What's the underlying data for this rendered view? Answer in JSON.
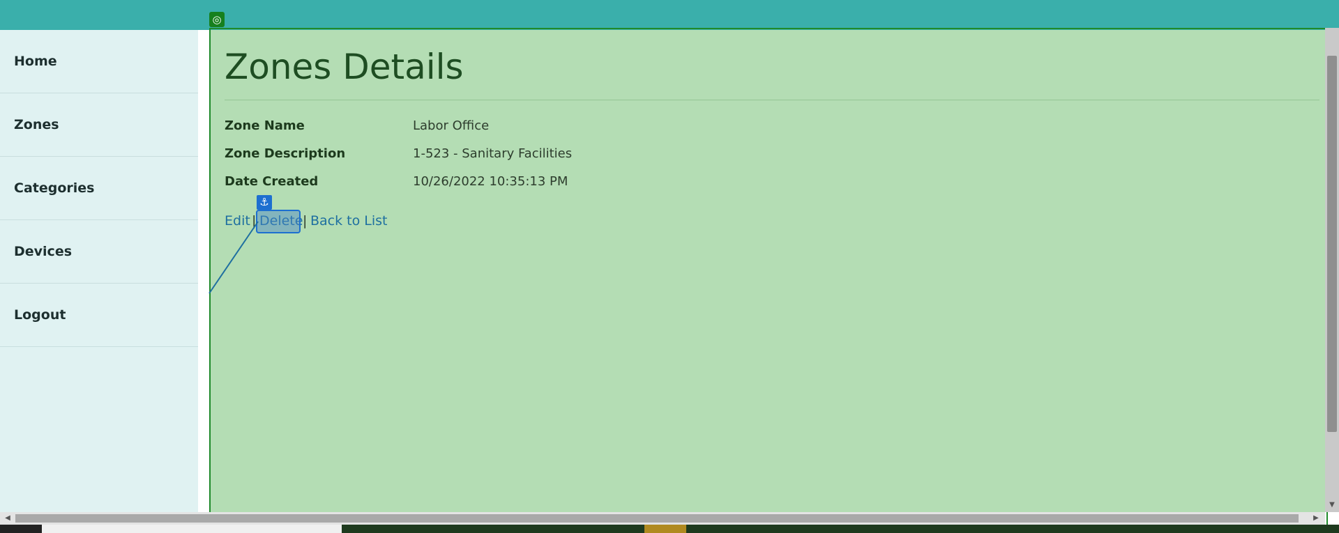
{
  "sidebar": {
    "items": [
      {
        "label": "Home"
      },
      {
        "label": "Zones"
      },
      {
        "label": "Categories"
      },
      {
        "label": "Devices"
      },
      {
        "label": "Logout"
      }
    ]
  },
  "main": {
    "title": "Zones Details",
    "details": [
      {
        "term": "Zone Name",
        "value": "Labor Office"
      },
      {
        "term": "Zone Description",
        "value": "1-523 - Sanitary Facilities"
      },
      {
        "term": "Date Created",
        "value": "10/26/2022 10:35:13 PM"
      }
    ],
    "actions": {
      "edit": "Edit",
      "separator": "|",
      "delete": "Delete",
      "back": "Back to List"
    }
  },
  "overlay": {
    "anchor_icon": "anchor-icon",
    "target_icon": "target-icon",
    "anchor_glyph": "⚓",
    "target_glyph": "◎"
  },
  "colors": {
    "header": "#3aafab",
    "sidebar": "#e0f2f2",
    "content_highlight": "#b4ddb4",
    "link": "#1e6fa0"
  }
}
